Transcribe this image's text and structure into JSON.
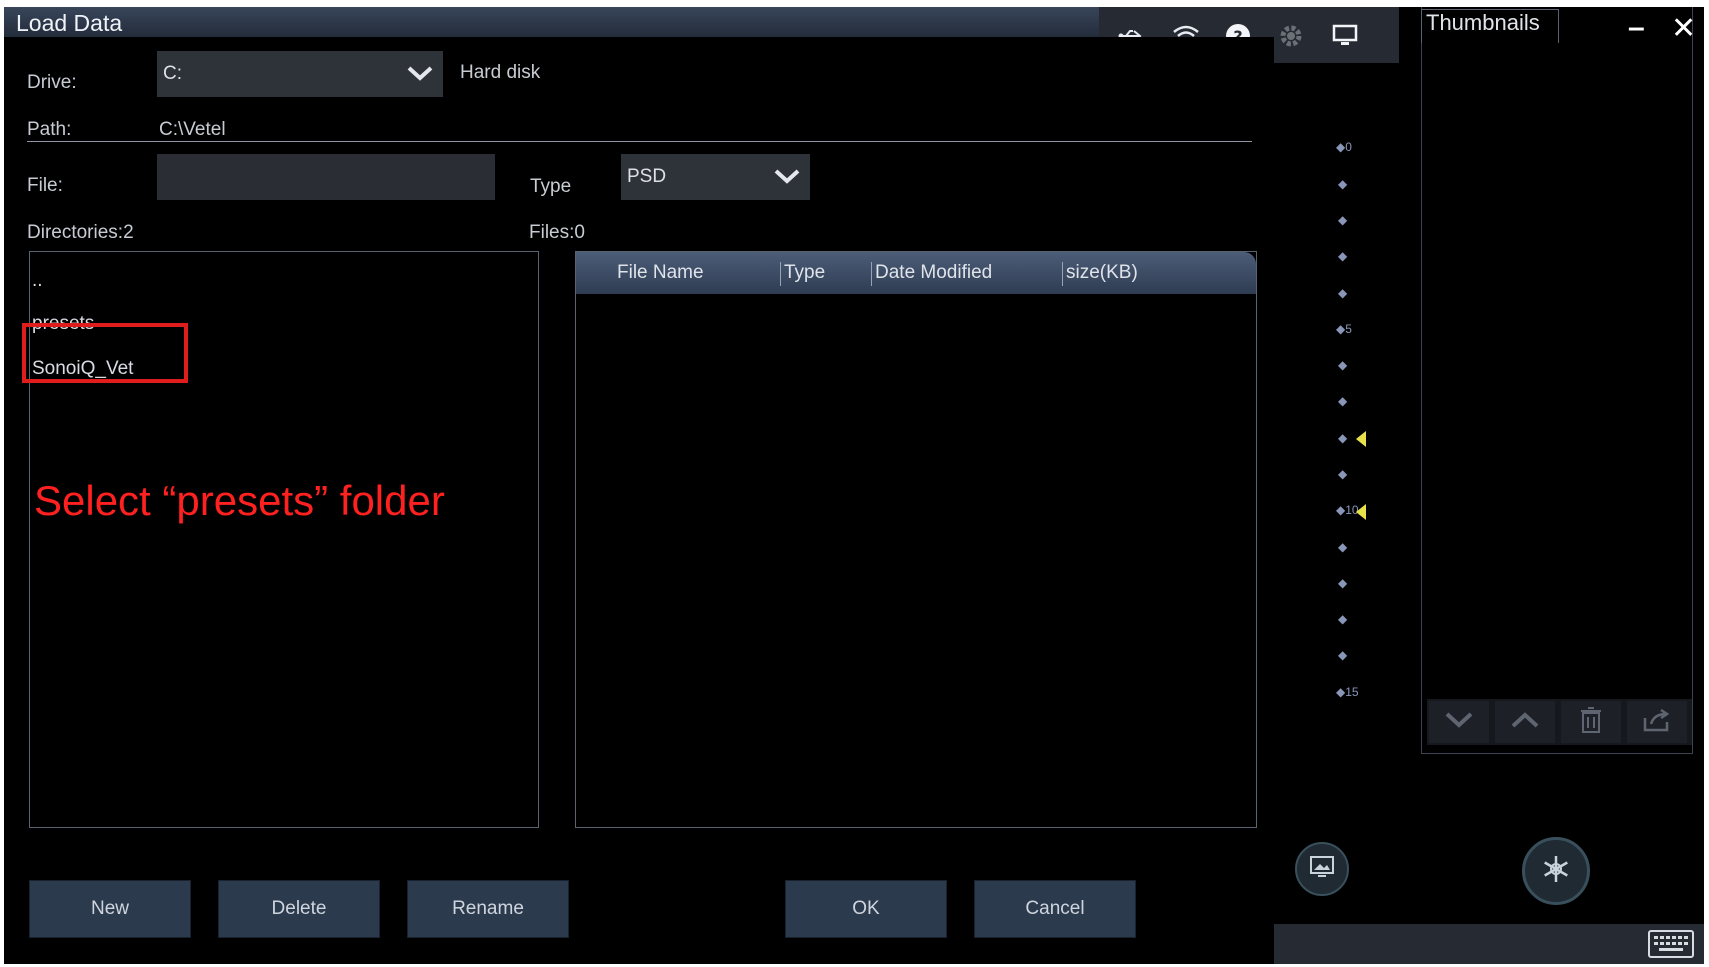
{
  "window": {
    "title": "Load Data"
  },
  "drive": {
    "label": "Drive:",
    "value": "C:",
    "description": "Hard disk"
  },
  "path": {
    "label": "Path:",
    "value": "C:\\Vetel"
  },
  "file": {
    "label": "File:",
    "value": ""
  },
  "type": {
    "label": "Type",
    "value": "PSD"
  },
  "directories": {
    "count_label": "Directories:2",
    "items": [
      "..",
      "presets",
      "SonoiQ_Vet"
    ]
  },
  "files": {
    "count_label": "Files:0",
    "columns": [
      "File Name",
      "Type",
      "Date Modified",
      "size(KB)"
    ],
    "rows": []
  },
  "annotation": {
    "text": "Select “presets” folder",
    "color": "#ff2020"
  },
  "buttons": {
    "new": "New",
    "delete": "Delete",
    "rename": "Rename",
    "ok": "OK",
    "cancel": "Cancel"
  },
  "thumbnails": {
    "tab_label": "Thumbnails",
    "minimize": "–",
    "close": "✕"
  },
  "depth_scale": {
    "labels": [
      "0",
      "5",
      "10",
      "15"
    ]
  },
  "status_icons": [
    "usb-icon",
    "wifi-icon",
    "help-icon",
    "settings-icon",
    "monitor-icon"
  ],
  "colors": {
    "accent": "#2c3a4d",
    "highlight": "#e01d1d",
    "marker": "#e8e24a"
  }
}
